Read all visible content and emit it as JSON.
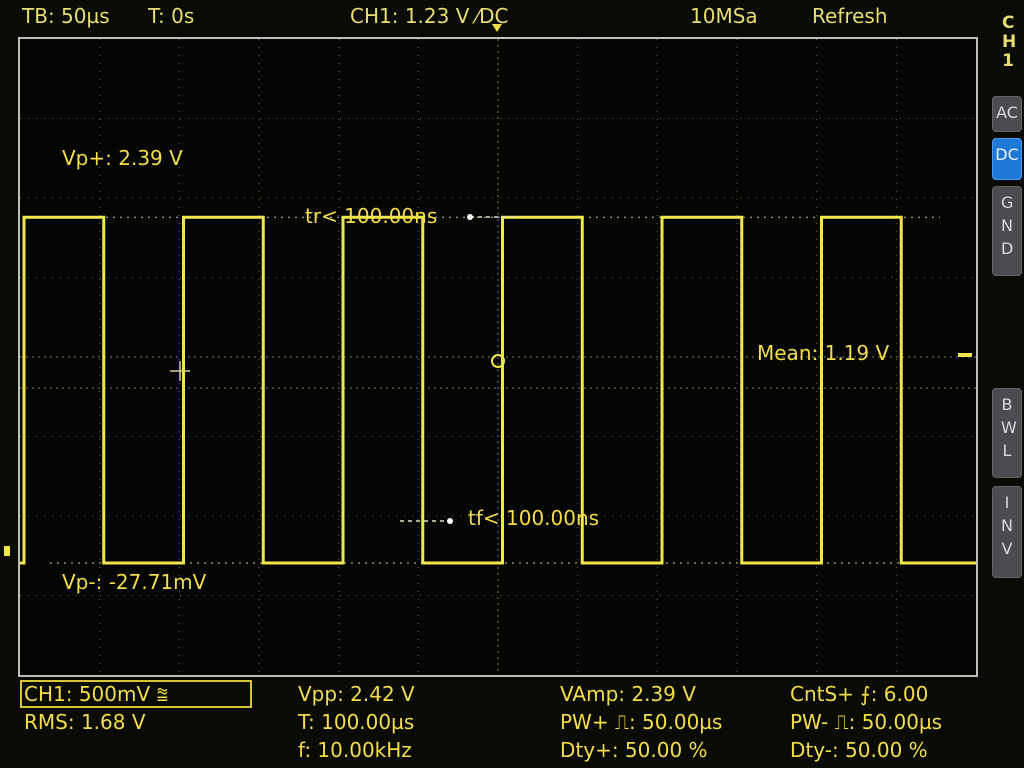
{
  "header": {
    "timebase": "TB: 50µs",
    "trigger_time": "T: 0s",
    "channel_trigger": "CH1: 1.23 V ⁄DC",
    "sample_rate": "10MSa",
    "mode": "Refresh"
  },
  "side_panel": {
    "channel": "CH1",
    "coupling_buttons": [
      "AC",
      "DC",
      "GND"
    ],
    "selected_coupling": "DC",
    "bwl_label": "BWL",
    "inv_label": "INV"
  },
  "annotations": {
    "vp_plus": "Vp+: 2.39 V",
    "rise_time": "tr< 100.00ns",
    "mean": "Mean: 1.19 V",
    "fall_time": "tf< 100.00ns",
    "vp_minus": "Vp-: -27.71mV"
  },
  "footer": {
    "channel_scale": "CH1: 500mV ⩰",
    "rms": "RMS: 1.68 V",
    "vpp": "Vpp: 2.42 V",
    "period": "T: 100.00µs",
    "frequency": "f: 10.00kHz",
    "vamp": "VAmp: 2.39 V",
    "pw_plus": "PW+ ⎍: 50.00µs",
    "duty_plus": "Dty+: 50.00 %",
    "cnt_plus": "CntS+ ⨍: 6.00",
    "pw_minus": "PW- ⎍: 50.00µs",
    "duty_minus": "Dty-: 50.00 %"
  },
  "waveform": {
    "high_level_v": 2.39,
    "low_level_v": -0.02771,
    "cycles_visible": 6,
    "duty": 0.5
  },
  "colors": {
    "trace": "#f0e84a",
    "text": "#f2dd4a",
    "grid": "#6a6a5a",
    "selected_button": "#1f78d6"
  }
}
